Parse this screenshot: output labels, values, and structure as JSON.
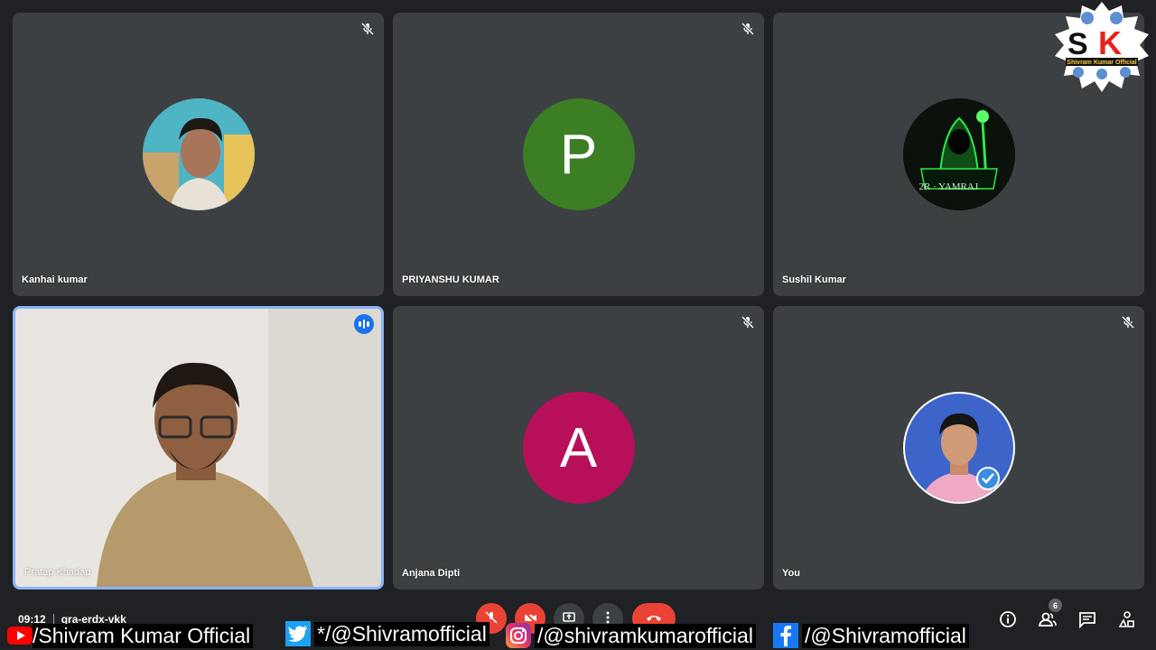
{
  "meeting": {
    "time": "09:12",
    "code": "qra-erdx-vkk",
    "participant_count": "6"
  },
  "participants": [
    {
      "name": "Kanhai kumar",
      "avatar": "photo",
      "muted": true
    },
    {
      "name": "PRIYANSHU KUMAR",
      "avatar_letter": "P",
      "avatar_color": "#3b7e23",
      "muted": true
    },
    {
      "name": "Sushil Kumar",
      "avatar": "photo",
      "avatar_caption": "2R · YAMRAJ",
      "muted": true
    },
    {
      "name": "Pratap Khadap",
      "video": "camera",
      "speaking": true
    },
    {
      "name": "Anjana Dipti",
      "avatar_letter": "A",
      "avatar_color": "#b80f5a",
      "muted": true
    },
    {
      "name": "You",
      "avatar": "photo",
      "muted": true
    }
  ],
  "watermark": {
    "label": "Shivram Kumar Official",
    "initials": "SK"
  },
  "social": {
    "youtube": "/Shivram Kumar Official",
    "twitter": "*/@Shivramofficial",
    "instagram": "/@shivramkumarofficial",
    "facebook": "/@Shivramofficial"
  },
  "colors": {
    "accent": "#8ab4f8",
    "end_call": "#ea4335",
    "tile_bg": "#3c4043",
    "page_bg": "#202124"
  }
}
